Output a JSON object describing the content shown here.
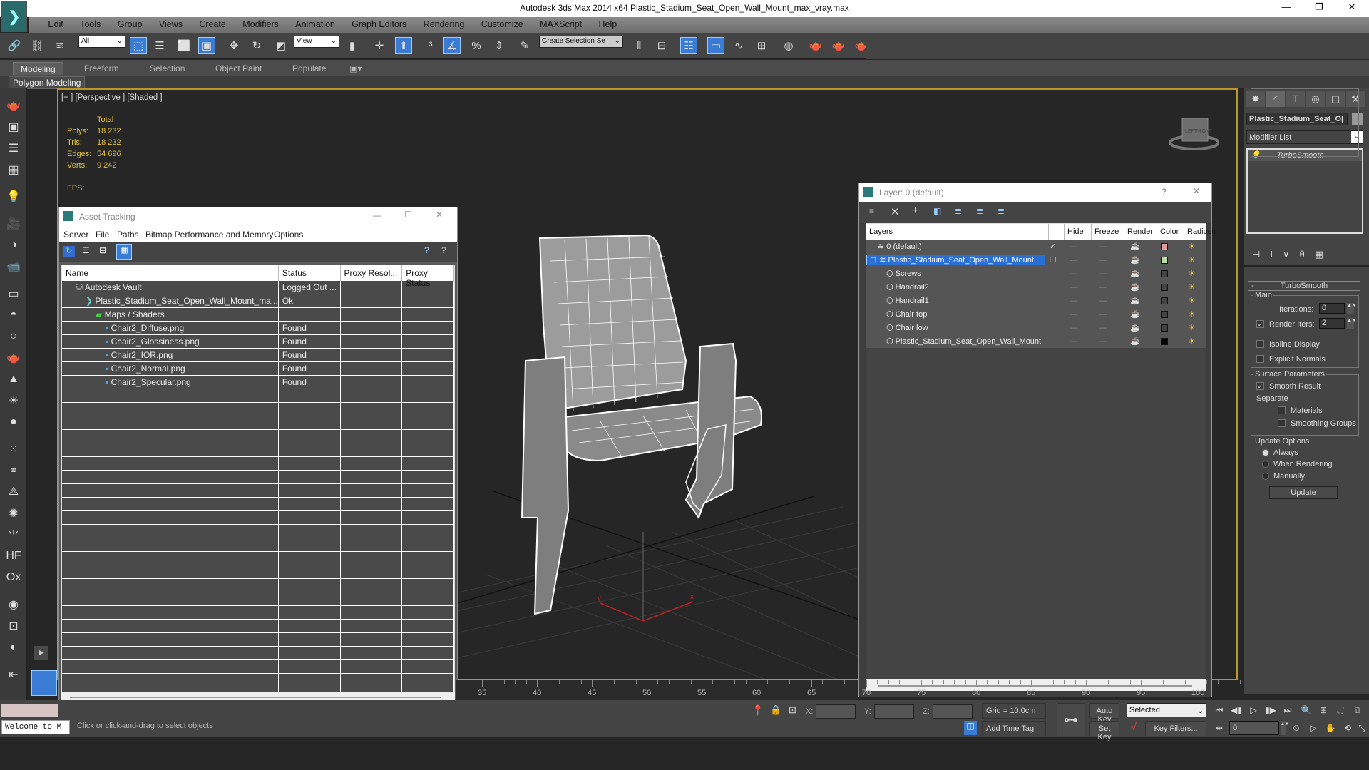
{
  "window": {
    "title": "Autodesk 3ds Max  2014 x64    Plastic_Stadium_Seat_Open_Wall_Mount_max_vray.max",
    "minimize": "—",
    "restore": "❐",
    "close": "✕"
  },
  "menubar": [
    "Edit",
    "Tools",
    "Group",
    "Views",
    "Create",
    "Modifiers",
    "Animation",
    "Graph Editors",
    "Rendering",
    "Customize",
    "MAXScript",
    "Help"
  ],
  "toolbar": {
    "selection_filter": "All",
    "ref_coord": "View",
    "named_selection": "Create Selection Se"
  },
  "ribbon": {
    "tabs": [
      "Modeling",
      "Freeform",
      "Selection",
      "Object Paint",
      "Populate"
    ],
    "active_tab": "Modeling",
    "panel_label": "Polygon Modeling"
  },
  "viewport": {
    "label": "[+ ] [Perspective ] [Shaded ]",
    "stats": {
      "header": "Total",
      "rows": [
        {
          "label": "Polys:",
          "value": "18 232"
        },
        {
          "label": "Tris:",
          "value": "18 232"
        },
        {
          "label": "Edges:",
          "value": "54 696"
        },
        {
          "label": "Verts:",
          "value": "9 242"
        }
      ],
      "fps_label": "FPS:"
    },
    "viewcube": {
      "left": "LEFT",
      "front": "FRONT"
    },
    "axis_labels": {
      "x": "x",
      "y": "y"
    }
  },
  "asset_tracking": {
    "title": "Asset Tracking",
    "menu": [
      "Server",
      "File",
      "Paths",
      "Bitmap Performance and Memory",
      "Options"
    ],
    "columns": [
      "Name",
      "Status",
      "Proxy Resol...",
      "Proxy Status"
    ],
    "rows": [
      {
        "name": "Autodesk Vault",
        "status": "Logged Out ...",
        "indent": 1,
        "icon": "vault-icon"
      },
      {
        "name": "Plastic_Stadium_Seat_Open_Wall_Mount_ma...",
        "status": "Ok",
        "indent": 2,
        "icon": "max-file-icon"
      },
      {
        "name": "Maps / Shaders",
        "status": "",
        "indent": 3,
        "icon": "maps-icon"
      },
      {
        "name": "Chair2_Diffuse.png",
        "status": "Found",
        "indent": 4,
        "icon": "image-file-icon"
      },
      {
        "name": "Chair2_Glossiness.png",
        "status": "Found",
        "indent": 4,
        "icon": "image-file-icon"
      },
      {
        "name": "Chair2_IOR.png",
        "status": "Found",
        "indent": 4,
        "icon": "image-file-icon"
      },
      {
        "name": "Chair2_Normal.png",
        "status": "Found",
        "indent": 4,
        "icon": "image-file-icon"
      },
      {
        "name": "Chair2_Specular.png",
        "status": "Found",
        "indent": 4,
        "icon": "image-file-icon"
      }
    ],
    "empty_rows": 23
  },
  "layer_manager": {
    "title": "Layer: 0 (default)",
    "help": "?",
    "close": "✕",
    "columns": [
      "Layers",
      "",
      "Hide",
      "Freeze",
      "Render",
      "Color",
      "Radiosit"
    ],
    "rows": [
      {
        "name": "0 (default)",
        "active": "✓",
        "color": "#e39a9a",
        "type": "layer",
        "selected": false,
        "indent": 1
      },
      {
        "name": "Plastic_Stadium_Seat_Open_Wall_Mount",
        "active": "☐",
        "color": "#b6e0a0",
        "type": "layer",
        "selected": true,
        "indent": 0
      },
      {
        "name": "Screws",
        "active": "",
        "color": "#444444",
        "type": "object",
        "selected": false,
        "indent": 2
      },
      {
        "name": "Handrail2",
        "active": "",
        "color": "#444444",
        "type": "object",
        "selected": false,
        "indent": 2
      },
      {
        "name": "Handrail1",
        "active": "",
        "color": "#444444",
        "type": "object",
        "selected": false,
        "indent": 2
      },
      {
        "name": "Chair top",
        "active": "",
        "color": "#444444",
        "type": "object",
        "selected": false,
        "indent": 2
      },
      {
        "name": "Chair low",
        "active": "",
        "color": "#444444",
        "type": "object",
        "selected": false,
        "indent": 2
      },
      {
        "name": "Plastic_Stadium_Seat_Open_Wall_Mount",
        "active": "",
        "color": "#000000",
        "type": "object",
        "selected": false,
        "indent": 2
      }
    ],
    "hide_glyph": "—",
    "freeze_glyph": "—",
    "render_glyph": "☕",
    "radiosity_glyph": "☀"
  },
  "command_panel": {
    "object_name": "Plastic_Stadium_Seat_O|",
    "modifier_list": "Modifier List",
    "stack": [
      "TurboSmooth"
    ],
    "rollout_title": "TurboSmooth",
    "collapse": "-",
    "main": {
      "group": "Main",
      "iterations_label": "Iterations:",
      "iterations": "0",
      "render_iters_label": "Render Iters:",
      "render_iters": "2",
      "render_iters_checked": true,
      "isoline_label": "Isoline Display",
      "isoline_checked": false,
      "explicit_normals_label": "Explicit Normals",
      "explicit_normals_checked": false
    },
    "surface": {
      "group": "Surface Parameters",
      "smooth_result_label": "Smooth Result",
      "smooth_result_checked": true,
      "separate_label": "Separate",
      "materials_label": "Materials",
      "smoothing_groups_label": "Smoothing Groups"
    },
    "update": {
      "group": "Update Options",
      "options": [
        "Always",
        "When Rendering",
        "Manually"
      ],
      "selected": "Always",
      "button": "Update"
    }
  },
  "timeline": {
    "ticks": [
      "35",
      "40",
      "45",
      "50",
      "55",
      "60",
      "65",
      "70",
      "75",
      "80",
      "85",
      "90",
      "95",
      "100"
    ]
  },
  "statusbar": {
    "maxscript_listener": "Welcome to M",
    "prompt": "Click or click-and-drag to select objects",
    "x_label": "X:",
    "y_label": "Y:",
    "z_label": "Z:",
    "grid": "Grid = 10,0cm",
    "add_time_tag": "Add Time Tag",
    "auto_key": "Auto Key",
    "set_key": "Set Key",
    "key_mode": "Selected",
    "key_filters": "Key Filters...",
    "current_frame": "0"
  }
}
